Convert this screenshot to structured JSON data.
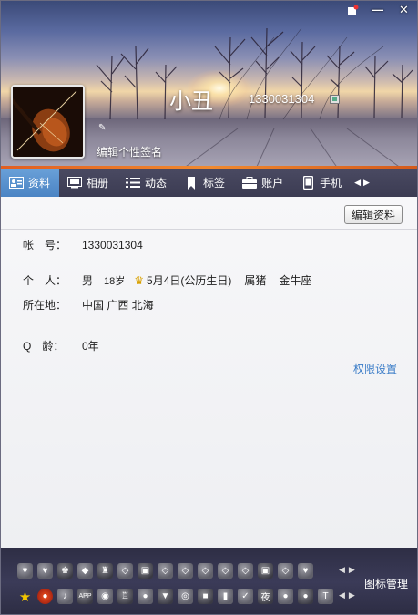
{
  "window": {
    "controls": [
      "skin",
      "minimize",
      "close"
    ]
  },
  "profile": {
    "nickname": "小丑",
    "qq_number": "1330031304",
    "signature_placeholder": "编辑个性签名"
  },
  "tabs": [
    {
      "label": "资料",
      "icon": "profile-card-icon",
      "active": true
    },
    {
      "label": "相册",
      "icon": "photo-album-icon",
      "active": false
    },
    {
      "label": "动态",
      "icon": "feed-list-icon",
      "active": false
    },
    {
      "label": "标签",
      "icon": "bookmark-tag-icon",
      "active": false
    },
    {
      "label": "账户",
      "icon": "briefcase-icon",
      "active": false
    },
    {
      "label": "手机",
      "icon": "mobile-phone-icon",
      "active": false
    }
  ],
  "content": {
    "edit_button": "编辑资料",
    "account": {
      "label": "帐　号：",
      "value": "1330031304"
    },
    "person": {
      "label": "个　人：",
      "gender": "男",
      "age": "18岁",
      "birthday": "5月4日(公历生日)",
      "zodiac": "属猪",
      "constellation": "金牛座"
    },
    "location": {
      "label": "所在地：",
      "value": "中国 广西 北海"
    },
    "qage": {
      "label": "Q　龄：",
      "value": "0年"
    },
    "permission_link": "权限设置"
  },
  "iconbar": {
    "manage_label": "图标管理"
  },
  "colors": {
    "accent_orange": "#e25e20",
    "active_tab": "#4b84c4",
    "link": "#3a7cc8"
  }
}
